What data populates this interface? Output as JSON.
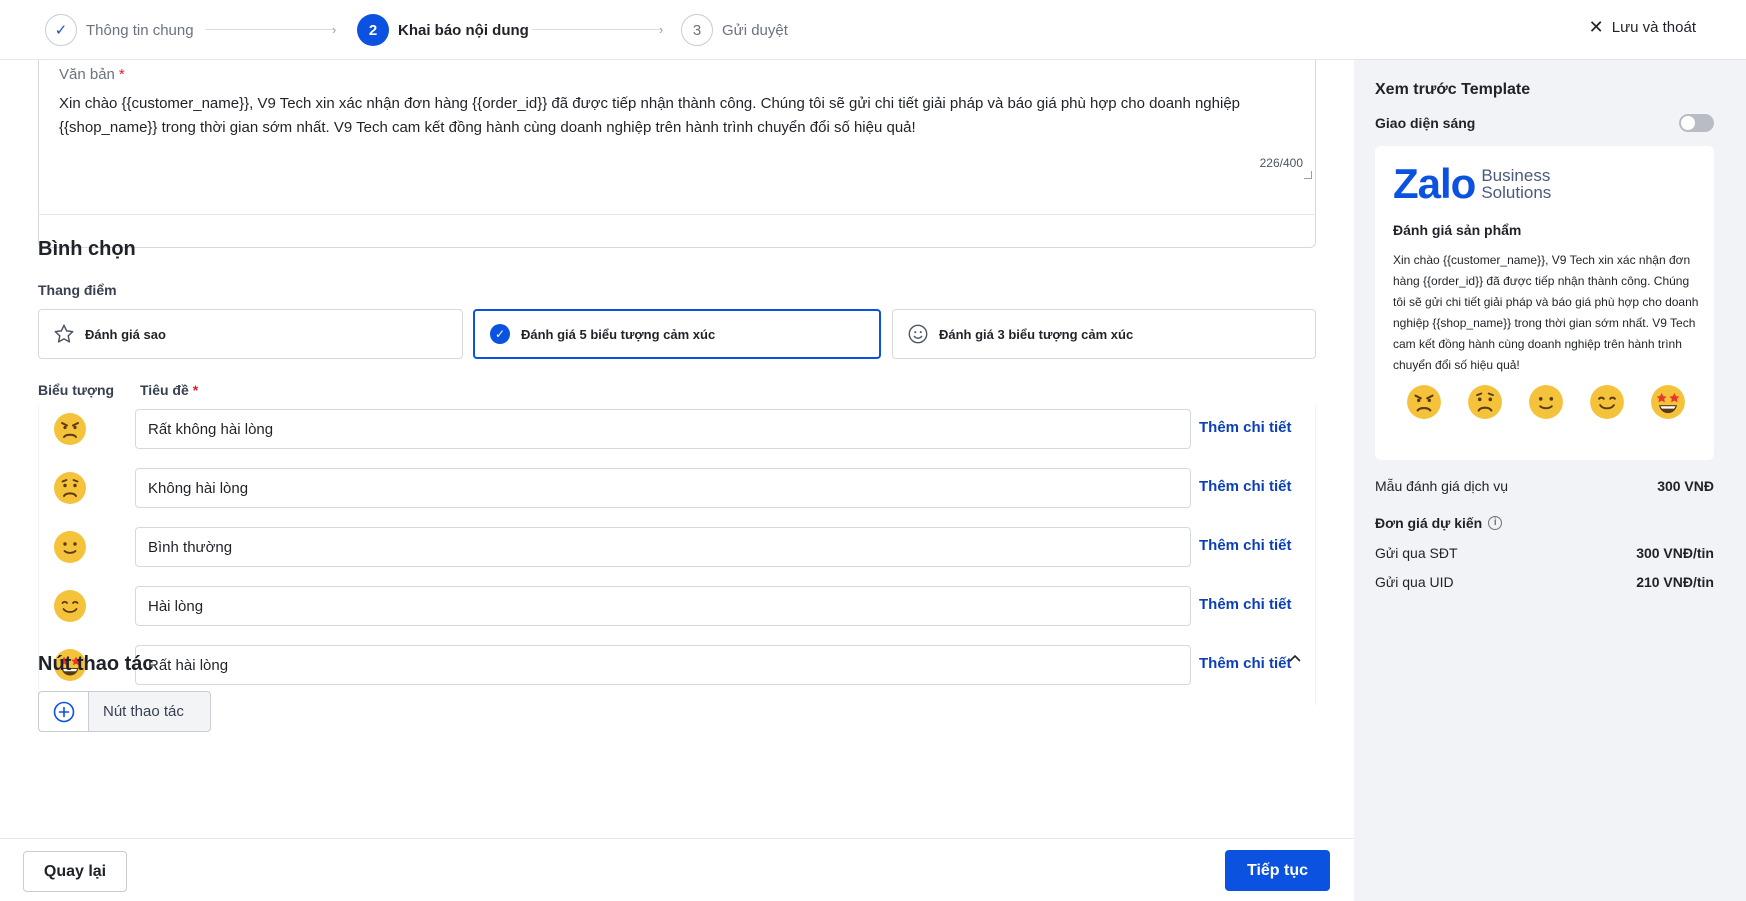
{
  "stepper": {
    "steps": [
      {
        "number": "✓",
        "label": "Thông tin chung"
      },
      {
        "number": "2",
        "label": "Khai báo nội dung"
      },
      {
        "number": "3",
        "label": "Gửi duyệt"
      }
    ],
    "save_exit": "Lưu và thoát"
  },
  "text_section": {
    "label": "Văn bản",
    "required_mark": "*",
    "value": "Xin chào {{customer_name}}, V9 Tech xin xác nhận đơn hàng {{order_id}} đã được tiếp nhận thành công. Chúng tôi sẽ gửi chi tiết giải pháp và báo giá phù hợp cho doanh nghiệp {{shop_name}} trong thời gian sớm nhất. V9 Tech cam kết đồng hành cùng doanh nghiệp trên hành trình chuyển đổi số hiệu quả!",
    "counter": "226/400"
  },
  "poll": {
    "title": "Bình chọn",
    "scale_label": "Thang điểm",
    "options": [
      {
        "label": "Đánh giá sao",
        "selected": false
      },
      {
        "label": "Đánh giá 5 biểu tượng cảm xúc",
        "selected": true
      },
      {
        "label": "Đánh giá 3 biểu tượng cảm xúc",
        "selected": false
      }
    ],
    "icon_col": "Biểu tượng",
    "title_col": "Tiêu đề",
    "required_mark": "*",
    "rows": [
      {
        "value": "Rất không hài lòng",
        "more": "Thêm chi tiết",
        "icon": "very-unhappy-emoji"
      },
      {
        "value": "Không hài lòng",
        "more": "Thêm chi tiết",
        "icon": "unhappy-emoji"
      },
      {
        "value": "Bình thường",
        "more": "Thêm chi tiết",
        "icon": "neutral-emoji"
      },
      {
        "value": "Hài lòng",
        "more": "Thêm chi tiết",
        "icon": "happy-emoji"
      },
      {
        "value": "Rất hài lòng",
        "more": "Thêm chi tiết",
        "icon": "star-eyes-emoji"
      }
    ]
  },
  "actions": {
    "title": "Nút thao tác",
    "add_button": "Nút thao tác"
  },
  "footer": {
    "back": "Quay lại",
    "next": "Tiếp tục"
  },
  "preview": {
    "title": "Xem trước Template",
    "theme_label": "Giao diện sáng",
    "theme_on": false,
    "logo_word": "Zalo",
    "logo_sub_1": "Business",
    "logo_sub_2": "Solutions",
    "card_title": "Đánh giá sản phẩm",
    "card_body": "Xin chào {{customer_name}}, V9 Tech xin xác nhận đơn hàng {{order_id}} đã được tiếp nhận thành công. Chúng tôi sẽ gửi chi tiết giải pháp và báo giá phù hợp cho doanh nghiệp {{shop_name}} trong thời gian sớm nhất. V9 Tech cam kết đồng hành cùng doanh nghiệp trên hành trình chuyển đổi số hiệu quả!",
    "pricing": {
      "service_label": "Mẫu đánh giá dịch vụ",
      "service_value": "300 VNĐ",
      "unit_price_label": "Đơn giá dự kiến",
      "phone_label": "Gửi qua SĐT",
      "phone_value": "300 VNĐ/tin",
      "uid_label": "Gửi qua UID",
      "uid_value": "210 VNĐ/tin"
    }
  },
  "colors": {
    "primary": "#0b52e0",
    "link": "#0b3fb8",
    "required": "#e11d2e",
    "emoji_fill": "#f5c33b"
  }
}
